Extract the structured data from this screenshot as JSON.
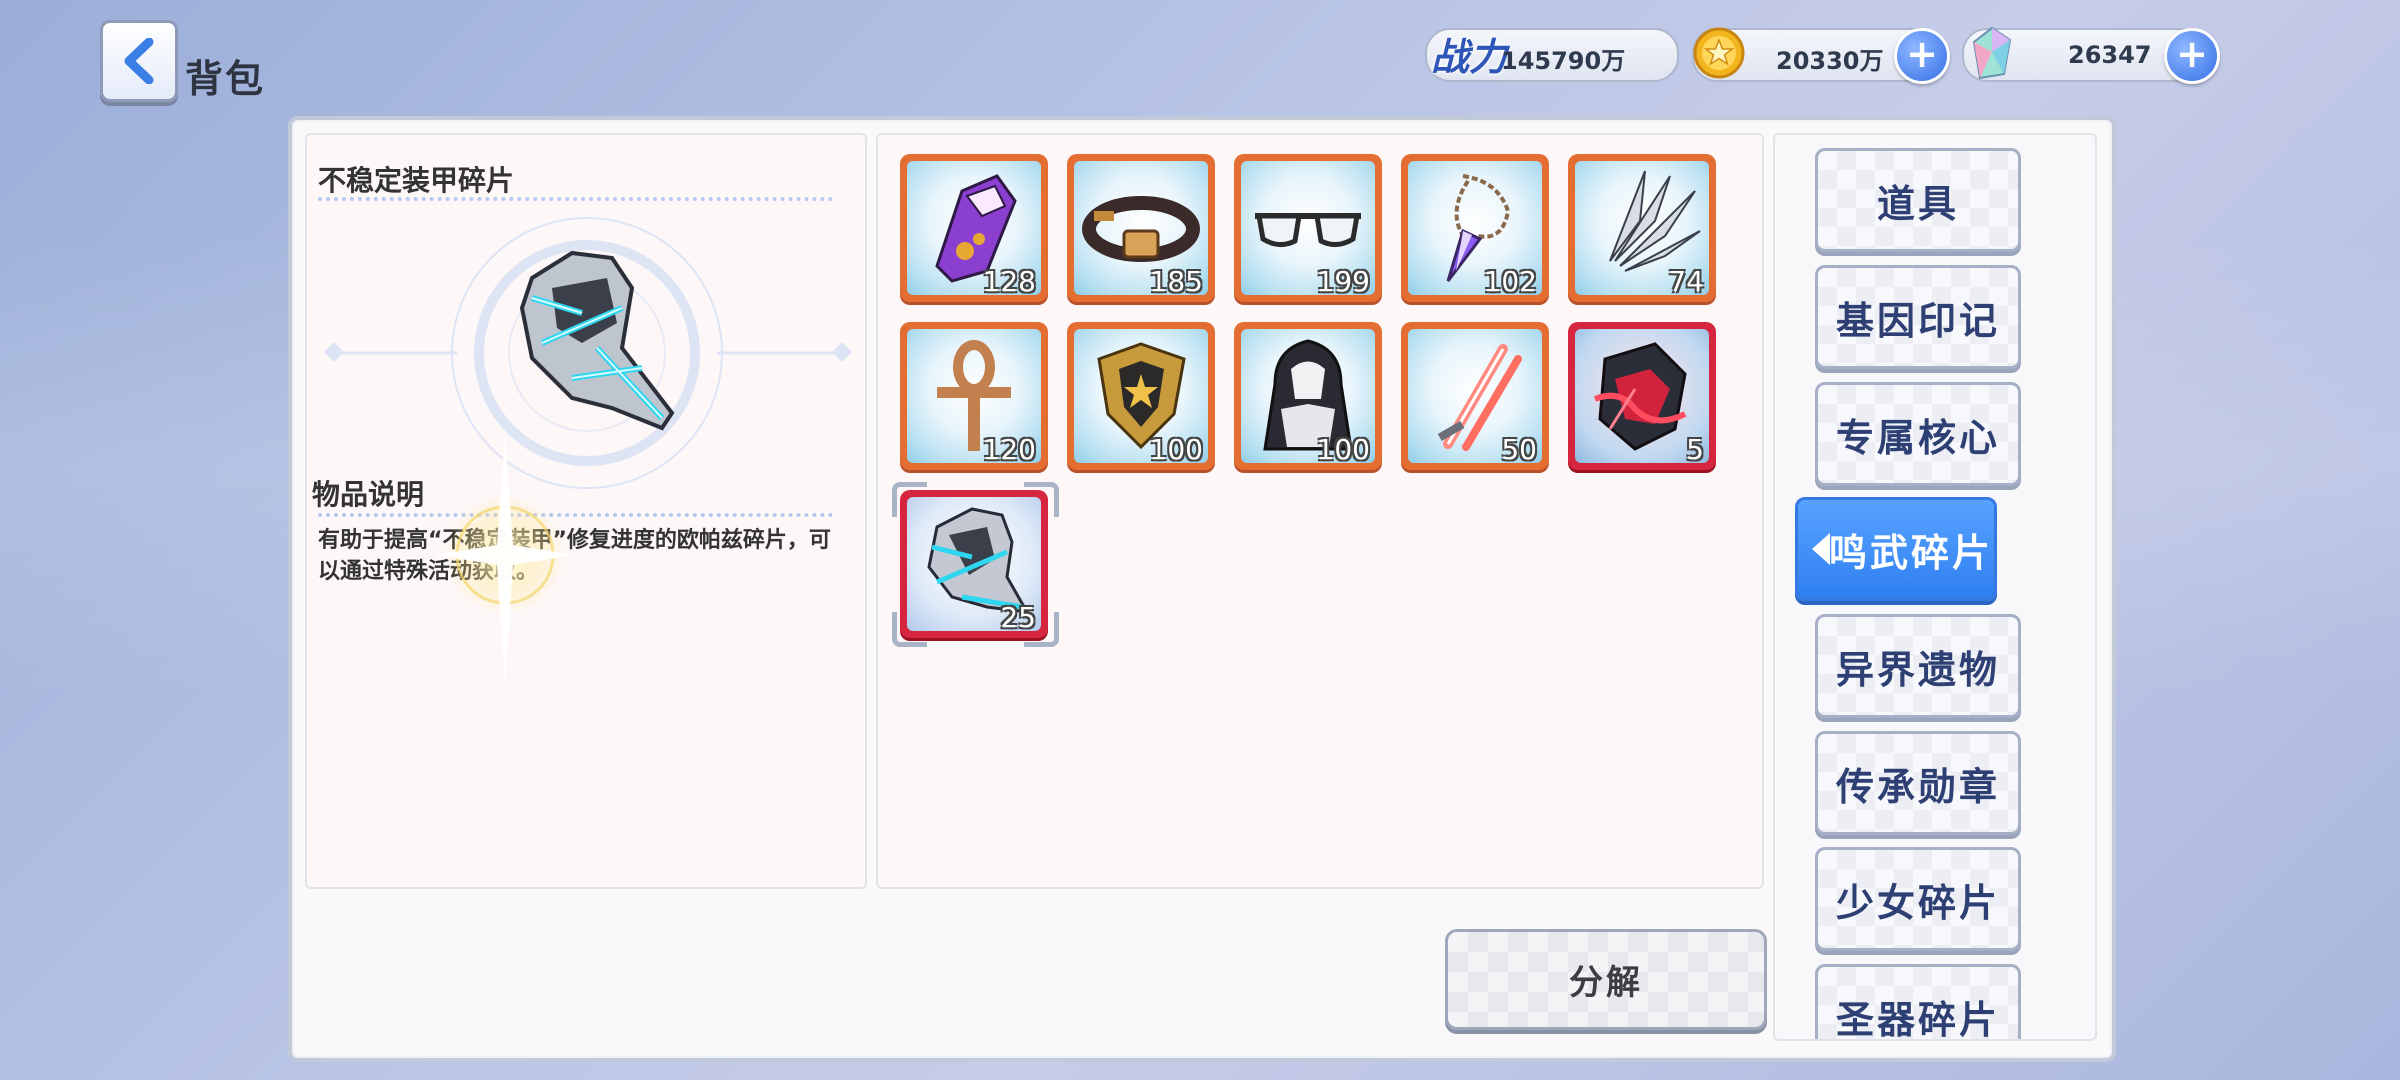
{
  "header": {
    "title": "背包",
    "power_label": "战力",
    "power_value": "145790万",
    "gold_value": "20330万",
    "gem_value": "26347"
  },
  "detail": {
    "item_name": "不稳定装甲碎片",
    "section_title": "物品说明",
    "description": "有助于提高“不稳定装甲”修复进度的欧帕兹碎片，可以通过特殊活动获取。"
  },
  "items": [
    {
      "icon": "purple-glove-icon",
      "qty": "128",
      "rarity": "orange"
    },
    {
      "icon": "leather-collar-icon",
      "qty": "185",
      "rarity": "orange"
    },
    {
      "icon": "sunglasses-icon",
      "qty": "199",
      "rarity": "orange"
    },
    {
      "icon": "crystal-pendant-icon",
      "qty": "102",
      "rarity": "orange"
    },
    {
      "icon": "silver-feathers-icon",
      "qty": "74",
      "rarity": "orange"
    },
    {
      "icon": "ankh-icon",
      "qty": "120",
      "rarity": "orange"
    },
    {
      "icon": "golden-shield-icon",
      "qty": "100",
      "rarity": "orange"
    },
    {
      "icon": "hooded-cloak-icon",
      "qty": "100",
      "rarity": "orange"
    },
    {
      "icon": "red-daggers-icon",
      "qty": "50",
      "rarity": "orange"
    },
    {
      "icon": "crimson-armor-icon",
      "qty": "5",
      "rarity": "red"
    },
    {
      "icon": "unstable-armor-fragment-icon",
      "qty": "25",
      "rarity": "red",
      "selected": true
    }
  ],
  "tabs": [
    {
      "label": "道具"
    },
    {
      "label": "基因印记"
    },
    {
      "label": "专属核心"
    },
    {
      "label": "鸣武碎片",
      "active": true
    },
    {
      "label": "异界遗物"
    },
    {
      "label": "传承勋章"
    },
    {
      "label": "少女碎片"
    },
    {
      "label": "圣器碎片"
    }
  ],
  "actions": {
    "decompose_label": "分解"
  },
  "colors": {
    "accent": "#3b86f5",
    "item_border_orange": "#e46e32",
    "item_border_red": "#d6253e",
    "tab_text": "#2e3f74"
  }
}
